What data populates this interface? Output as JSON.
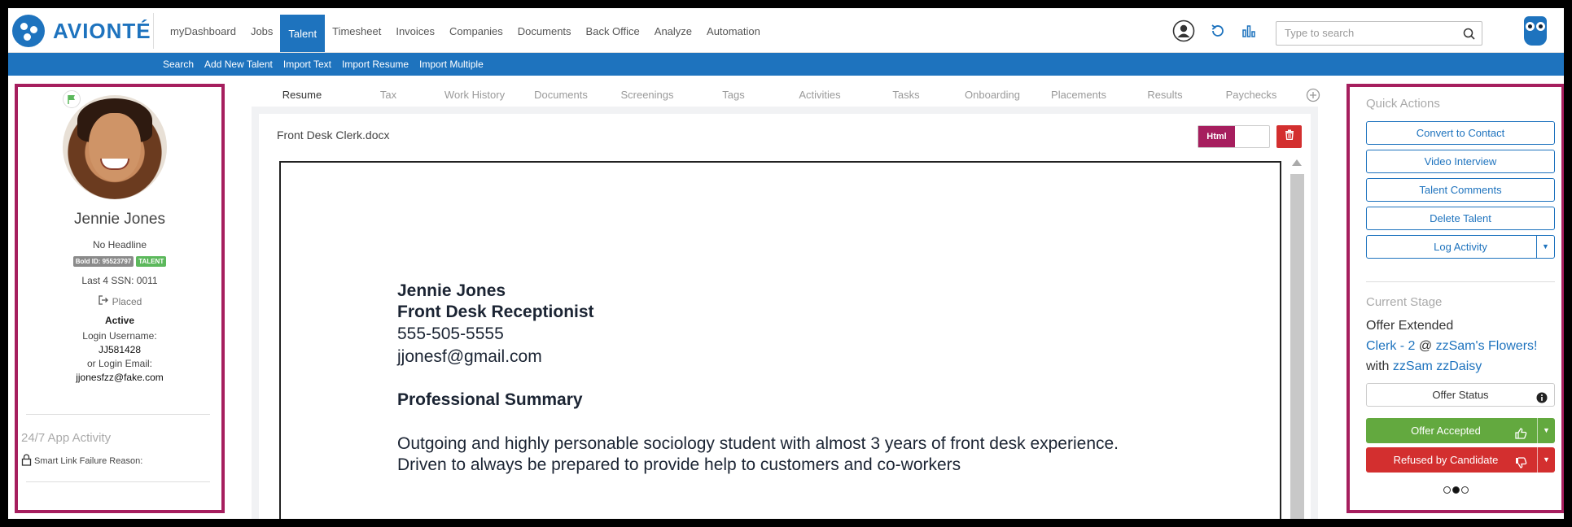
{
  "brand": {
    "name": "AVIONTÉ",
    "color": "#1e73be"
  },
  "nav": {
    "items": [
      "myDashboard",
      "Jobs",
      "Talent",
      "Timesheet",
      "Invoices",
      "Companies",
      "Documents",
      "Back Office",
      "Analyze",
      "Automation"
    ],
    "active": "Talent"
  },
  "search": {
    "placeholder": "Type to search"
  },
  "subnav": {
    "items": [
      "Search",
      "Add New Talent",
      "Import Text",
      "Import Resume",
      "Import Multiple"
    ]
  },
  "profile": {
    "name": "Jennie Jones",
    "headline": "No Headline",
    "bold_id": "Bold ID: 95523797",
    "type_badge": "TALENT",
    "ssn": "Last 4 SSN: 0011",
    "placement_status": "Placed",
    "status": "Active",
    "login_username_label": "Login Username:",
    "login_username": "JJ581428",
    "login_email_label": "or Login Email:",
    "login_email": "jjonesfzz@fake.com",
    "app_activity_title": "24/7 App Activity",
    "smart_link_label": "Smart Link Failure Reason:"
  },
  "tabs": [
    "Resume",
    "Tax",
    "Work History",
    "Documents",
    "Screenings",
    "Tags",
    "Activities",
    "Tasks",
    "Onboarding",
    "Placements",
    "Results",
    "Paychecks"
  ],
  "active_tab": "Resume",
  "resume": {
    "file_name": "Front Desk Clerk.docx",
    "toggle_label": "Html",
    "doc": {
      "name": "Jennie Jones",
      "role": "Front Desk Receptionist",
      "phone": "555-505-5555",
      "email": "jjonesf@gmail.com",
      "section_title": "Professional Summary",
      "summary": "Outgoing and highly personable sociology student with almost 3 years of front desk experience. Driven to always be prepared to provide help to customers and co-workers"
    }
  },
  "quick_actions": {
    "title": "Quick Actions",
    "buttons": [
      "Convert to Contact",
      "Video Interview",
      "Talent Comments",
      "Delete Talent",
      "Log Activity"
    ]
  },
  "current_stage": {
    "title": "Current Stage",
    "stage": "Offer Extended",
    "job_link": "Clerk - 2",
    "at": "@",
    "company_link": "zzSam's Flowers!",
    "with": "with",
    "contact_link": "zzSam zzDaisy",
    "offer_status_label": "Offer Status",
    "accept_label": "Offer Accepted",
    "refuse_label": "Refused by Candidate",
    "accept_color": "#63a93f",
    "refuse_color": "#d32f2f"
  },
  "accent_colors": {
    "highlight_border": "#a61e5e",
    "primary": "#1e73be"
  }
}
